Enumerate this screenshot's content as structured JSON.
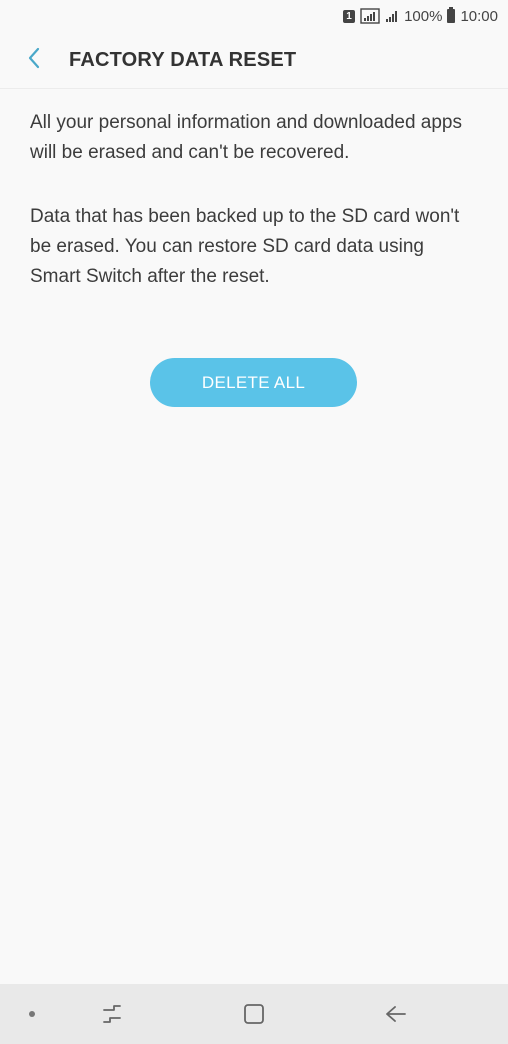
{
  "status_bar": {
    "sim_label": "1",
    "battery_text": "100%",
    "time": "10:00"
  },
  "header": {
    "back_icon": "chevron-left-icon",
    "title": "FACTORY DATA RESET"
  },
  "content": {
    "paragraph_1": "All your personal information and downloaded apps will be erased and can't be recovered.",
    "paragraph_2": "Data that has been backed up to the SD card won't be erased. You can restore SD card data using Smart Switch after the reset."
  },
  "actions": {
    "delete_all_label": "DELETE ALL"
  },
  "nav_bar": {
    "items": [
      "dot-icon",
      "recents-icon",
      "home-icon",
      "back-arrow-icon"
    ]
  },
  "colors": {
    "accent": "#5ac3e8",
    "back_chevron": "#4aa8c9",
    "background": "#f9f9f9",
    "nav_bar": "#e9e9e9"
  }
}
